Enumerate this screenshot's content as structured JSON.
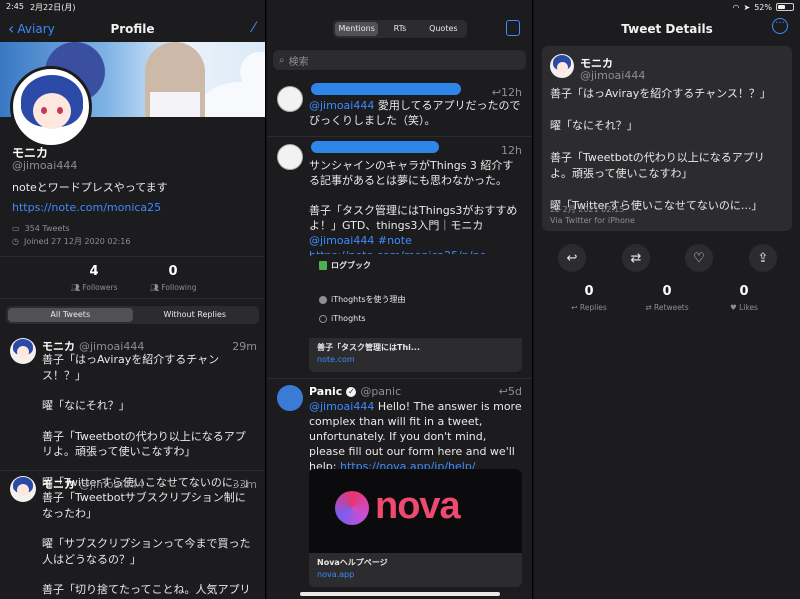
{
  "status_bar": {
    "time": "2:45",
    "date": "2月22日(月)",
    "battery": "52%",
    "battery_level": 0.52
  },
  "profile": {
    "back_label": "Aviary",
    "title": "Profile",
    "name": "モニカ",
    "handle": "@jimoai444",
    "bio": "noteとワードプレスやってます",
    "link": "https://note.com/monica25",
    "tweets_count": "354 Tweets",
    "joined": "Joined 27 12月 2020 02:16",
    "followers_num": "4",
    "followers_label": "Followers",
    "following_num": "0",
    "following_label": "Following",
    "tab_all": "All Tweets",
    "tab_without_replies": "Without Replies",
    "tweets": [
      {
        "name": "モニカ",
        "handle": "@jimoai444",
        "time": "29m",
        "lines": [
          "善子「はっAvirayを紹介するチャンス！？」",
          "曜「なにそれ？」",
          "善子「Tweetbotの代わり以上になるアプリよ。頑張って使いこなすわ」",
          "曜「Twitterすら使いこなせてないのに...」"
        ]
      },
      {
        "name": "モニカ",
        "handle": "@jimoai444",
        "time": "33m",
        "lines": [
          "善子「Tweetbotサブスクリプション制になったわ」",
          "曜「サブスクリプションって今まで買った人はどうなるの？」",
          "善子「切り捨てたってことね。人気アプリだからそれでも使う人多いでしょうね」"
        ]
      }
    ]
  },
  "mentions": {
    "tabs": [
      "Mentions",
      "RTs",
      "Quotes"
    ],
    "search_placeholder": "検索",
    "items": [
      {
        "time": "12h",
        "mention": "@jimoai444",
        "text": " 愛用してるアプリだったのでびっくりしました（笑）。"
      },
      {
        "time": "12h",
        "p1": "サンシャインのキャラがThings 3 紹介する記事があるとは夢にも思わなかった。",
        "p2": "善子「タスク管理にはThings3がおすすめよ！」GTD、things3入門｜モニカ",
        "p3_mention": "@jimoai444",
        "p3_hash": "#note",
        "p3_link": "https://note.com/monica25/n/ne...",
        "card_image_title": "ログブック",
        "card_item1": "iThoghtsを使う理由",
        "card_item2": "iThoghts",
        "card_title": "善子「タスク管理にはThi...",
        "card_url": "note.com"
      },
      {
        "name": "Panic",
        "handle": "@panic",
        "time": "5d",
        "mention": "@jimoai444",
        "text": " Hello! The answer is more complex than will fit in a tweet, unfortunately. If you don't mind, please fill out our form here and we'll help: ",
        "link": "https://nova.app/jp/help/",
        "card_logo": "nova",
        "card_title": "Novaヘルプページ",
        "card_url": "nova.app"
      }
    ]
  },
  "details": {
    "title": "Tweet Details",
    "name": "モニカ",
    "handle": "@jimoai444",
    "lines": [
      "善子「はっAvirayを紹介するチャンス！？」",
      "曜「なにそれ？」",
      "善子「Tweetbotの代わり以上になるアプリよ。頑張って使いこなすわ」",
      "曜「Twitterすら使いこなせてないのに...」"
    ],
    "date": "22 2月 2021 02:15",
    "via": "Via Twitter for iPhone",
    "replies_num": "0",
    "replies_label": "Replies",
    "retweets_num": "0",
    "retweets_label": "Retweets",
    "likes_num": "0",
    "likes_label": "Likes"
  }
}
